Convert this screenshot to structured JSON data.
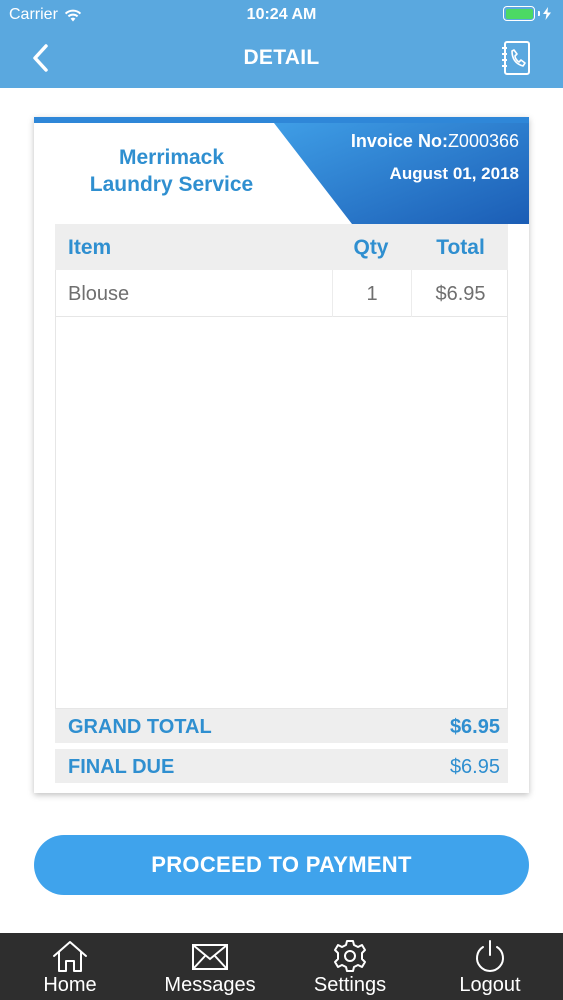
{
  "status_bar": {
    "carrier": "Carrier",
    "time": "10:24 AM"
  },
  "nav": {
    "title": "DETAIL",
    "back_icon": "chevron-left-icon",
    "contact_icon": "address-book-phone-icon"
  },
  "invoice": {
    "company_line1": "Merrimack",
    "company_line2": "Laundry Service",
    "invoice_no_label": "Invoice No:",
    "invoice_no": "Z000366",
    "date": "August 01, 2018",
    "columns": {
      "item": "Item",
      "qty": "Qty",
      "total": "Total"
    },
    "rows": [
      {
        "item": "Blouse",
        "qty": "1",
        "total": "$6.95"
      }
    ],
    "grand_total_label": "GRAND TOTAL",
    "grand_total": "$6.95",
    "final_due_label": "FINAL DUE",
    "final_due": "$6.95"
  },
  "actions": {
    "pay_label": "PROCEED TO PAYMENT"
  },
  "tabs": [
    {
      "label": "Home",
      "icon": "home-icon"
    },
    {
      "label": "Messages",
      "icon": "envelope-icon"
    },
    {
      "label": "Settings",
      "icon": "gear-icon"
    },
    {
      "label": "Logout",
      "icon": "power-icon"
    }
  ],
  "colors": {
    "header": "#5aa8df",
    "accent": "#2f8fd0",
    "button": "#3fa3ec",
    "tab_bar": "#2e2e2e",
    "battery": "#4cd964"
  }
}
